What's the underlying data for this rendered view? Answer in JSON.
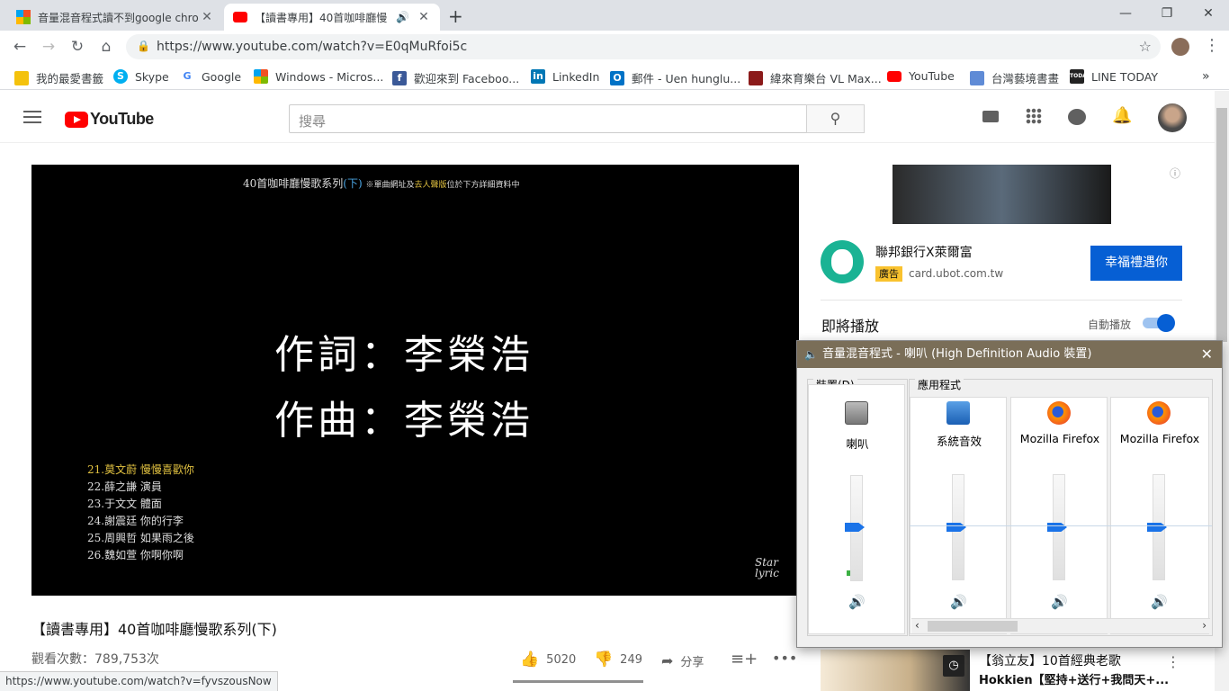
{
  "browser": {
    "tabs": [
      {
        "title": "音量混音程式讀不到google chro",
        "active": false
      },
      {
        "title": "【讀書專用】40首咖啡廳慢",
        "active": true
      }
    ],
    "url": "https://www.youtube.com/watch?v=E0qMuRfoi5c"
  },
  "bookmarks": [
    {
      "label": "我的最愛書籤",
      "icon": "folder-icon",
      "color": "#f4c20d"
    },
    {
      "label": "Skype",
      "icon": "skype-icon",
      "color": "#00aff0"
    },
    {
      "label": "Google",
      "icon": "google-icon",
      "color": "#4285f4"
    },
    {
      "label": "Windows - Micros...",
      "icon": "windows-icon",
      "color": "#f25022"
    },
    {
      "label": "歡迎來到 Faceboo...",
      "icon": "facebook-icon",
      "color": "#3b5998"
    },
    {
      "label": "LinkedIn",
      "icon": "linkedin-icon",
      "color": "#0077b5"
    },
    {
      "label": "郵件 - Uen hunglu...",
      "icon": "outlook-icon",
      "color": "#0072c6"
    },
    {
      "label": "緯來育樂台 VL Max...",
      "icon": "vl-icon",
      "color": "#8b1a1a"
    },
    {
      "label": "YouTube",
      "icon": "youtube-icon",
      "color": "#ff0000"
    },
    {
      "label": "台灣藝境書畫",
      "icon": "page-icon",
      "color": "#5f8bd6"
    },
    {
      "label": "LINE TODAY",
      "icon": "line-today-icon",
      "color": "#222222"
    }
  ],
  "youtube": {
    "logo_text": "YouTube",
    "search_placeholder": "搜尋",
    "video": {
      "title_overlay": "40首咖啡廳慢歌系列",
      "title_overlay_paren": "(下)",
      "title_overlay_note_prefix": "※單曲網址及",
      "title_overlay_note_highlight": "去人聲版",
      "title_overlay_note_suffix": "位於下方詳細資料中",
      "lyric_line1": "作詞：李榮浩",
      "lyric_line2": "作曲：李榮浩",
      "tracklist": [
        {
          "text": "21.莫文蔚 慢慢喜歡你",
          "current": true
        },
        {
          "text": "22.薛之謙 演員",
          "current": false
        },
        {
          "text": "23.于文文 體面",
          "current": false
        },
        {
          "text": "24.謝震廷 你的行李",
          "current": false
        },
        {
          "text": "25.周興哲 如果雨之後",
          "current": false
        },
        {
          "text": "26.魏如萱 你啊你啊",
          "current": false
        }
      ],
      "watermark1": "Star",
      "watermark2": "lyric"
    },
    "video_title": "【讀書專用】40首咖啡廳慢歌系列(下)",
    "views": "觀看次數：789,753次",
    "likes": "5020",
    "dislikes": "249",
    "share_label": "分享",
    "ad": {
      "advertiser": "聯邦銀行X萊爾富",
      "badge": "廣告",
      "domain": "card.ubot.com.tw",
      "cta": "幸福禮遇你"
    },
    "up_next_label": "即將播放",
    "autoplay_label": "自動播放",
    "autoplay_on": true,
    "next_video": {
      "title": "【翁立友】10首經典老歌",
      "subtitle": "Hokkien【堅持+送行+我問天+..."
    }
  },
  "status_url": "https://www.youtube.com/watch?v=fyvszousNow",
  "mixer": {
    "title": "音量混音程式 - 喇叭 (High Definition Audio 裝置)",
    "device_group": "裝置(D)",
    "apps_group": "應用程式",
    "channels": [
      {
        "name": "喇叭",
        "icon": "speaker-icon"
      },
      {
        "name": "系統音效",
        "icon": "system-sounds-icon"
      },
      {
        "name": "Mozilla Firefox",
        "icon": "firefox-icon"
      },
      {
        "name": "Mozilla Firefox",
        "icon": "firefox-icon"
      }
    ],
    "level": 0.48
  }
}
